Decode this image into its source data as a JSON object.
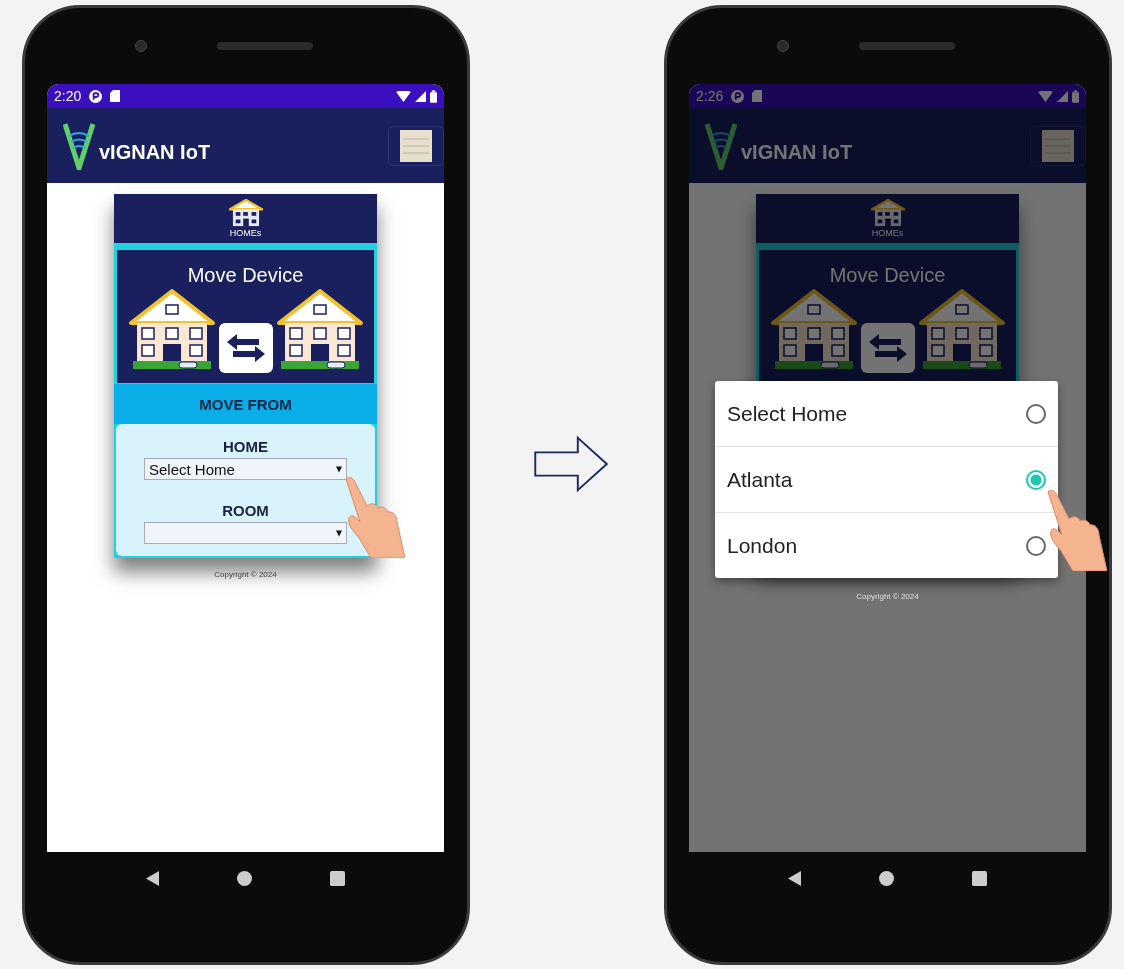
{
  "screens": [
    {
      "status_bar": {
        "time": "2:20"
      },
      "app_bar": {
        "title": "vIGNAN IoT"
      },
      "card": {
        "header_label": "HOMEs",
        "banner_title": "Move Device",
        "section_title": "MOVE FROM",
        "fields": [
          {
            "label": "HOME",
            "value": "Select Home"
          },
          {
            "label": "ROOM"
          }
        ]
      },
      "footer": "Copyright © 2024"
    },
    {
      "status_bar": {
        "time": "2:26"
      },
      "app_bar": {
        "title": "vIGNAN IoT"
      },
      "card": {
        "header_label": "HOMEs",
        "banner_title": "Move Device"
      },
      "footer": "Copyright © 2024",
      "dialog": {
        "options": [
          {
            "label": "Select Home",
            "selected": false
          },
          {
            "label": "Atlanta",
            "selected": true
          },
          {
            "label": "London",
            "selected": false
          }
        ]
      }
    }
  ]
}
